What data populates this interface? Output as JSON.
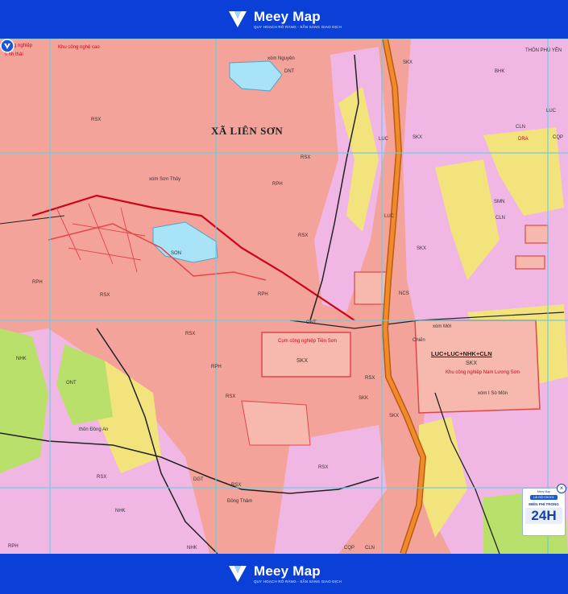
{
  "header": {
    "brand": "Meey Map",
    "tagline": "QUY HOẠCH RÕ RÀNG - SẴN SÀNG GIAO DỊCH"
  },
  "footer": {
    "brand": "Meey Map",
    "tagline": "QUY HOẠCH RÕ RÀNG - SẴN SÀNG GIAO DỊCH"
  },
  "map": {
    "commune": "XÃ LIÊN SƠN",
    "labels": {
      "nong_nghiep": "Nông nghiệp",
      "s_nh_thai": "s nh thái",
      "kcn_cao": "Khu công nghệ cao",
      "xom_nguyen": "xóm Nguyên",
      "xom_son_thuy": "xóm Sơn Thủy",
      "son": "SON",
      "ccn_tien_son": "Cụm công nghiệp Tiền Sơn",
      "kcn_nam_luong_son": "Khu công nghiệp Nam Lương Sơn",
      "thon_dong_an": "thôn Đồng An",
      "dong_tham": "Đồng Thâm",
      "xom_moi": "xóm Mới",
      "chien": "Chiến",
      "xom_i_so_mon": "xóm I Sò Môn",
      "thon_phu_yen": "THÔN PHÚ YÊN",
      "lucluc": "LUC+LUC+NHK+CLN",
      "skx": "SKX",
      "cln": "CLN",
      "luc": "LUC",
      "rsx": "RSX",
      "rph": "RPH",
      "dnt": "DNT",
      "nhk": "NHK",
      "ont": "ONT",
      "ncs": "NCS",
      "bhk": "BHK",
      "cqp": "CQP",
      "smn": "SMN",
      "skk": "SKK",
      "dra": "DRA",
      "dgt": "DGT"
    }
  },
  "ad": {
    "header": "Meey Map",
    "pill": "LÀI BỘI SHOCK",
    "line": "MIỄN PHÍ TRONG",
    "big": "24H",
    "close": "×"
  },
  "colors": {
    "brand_blue": "#0a3fd8",
    "forest_pink": "#f4a39a",
    "residential_pink": "#f0b7e4",
    "agri_yellow": "#f3e37d",
    "crop_green": "#b9e06a",
    "water_blue": "#a9e3f7",
    "road_orange": "#f08a2a",
    "grid_cyan": "#5fd0e4"
  }
}
